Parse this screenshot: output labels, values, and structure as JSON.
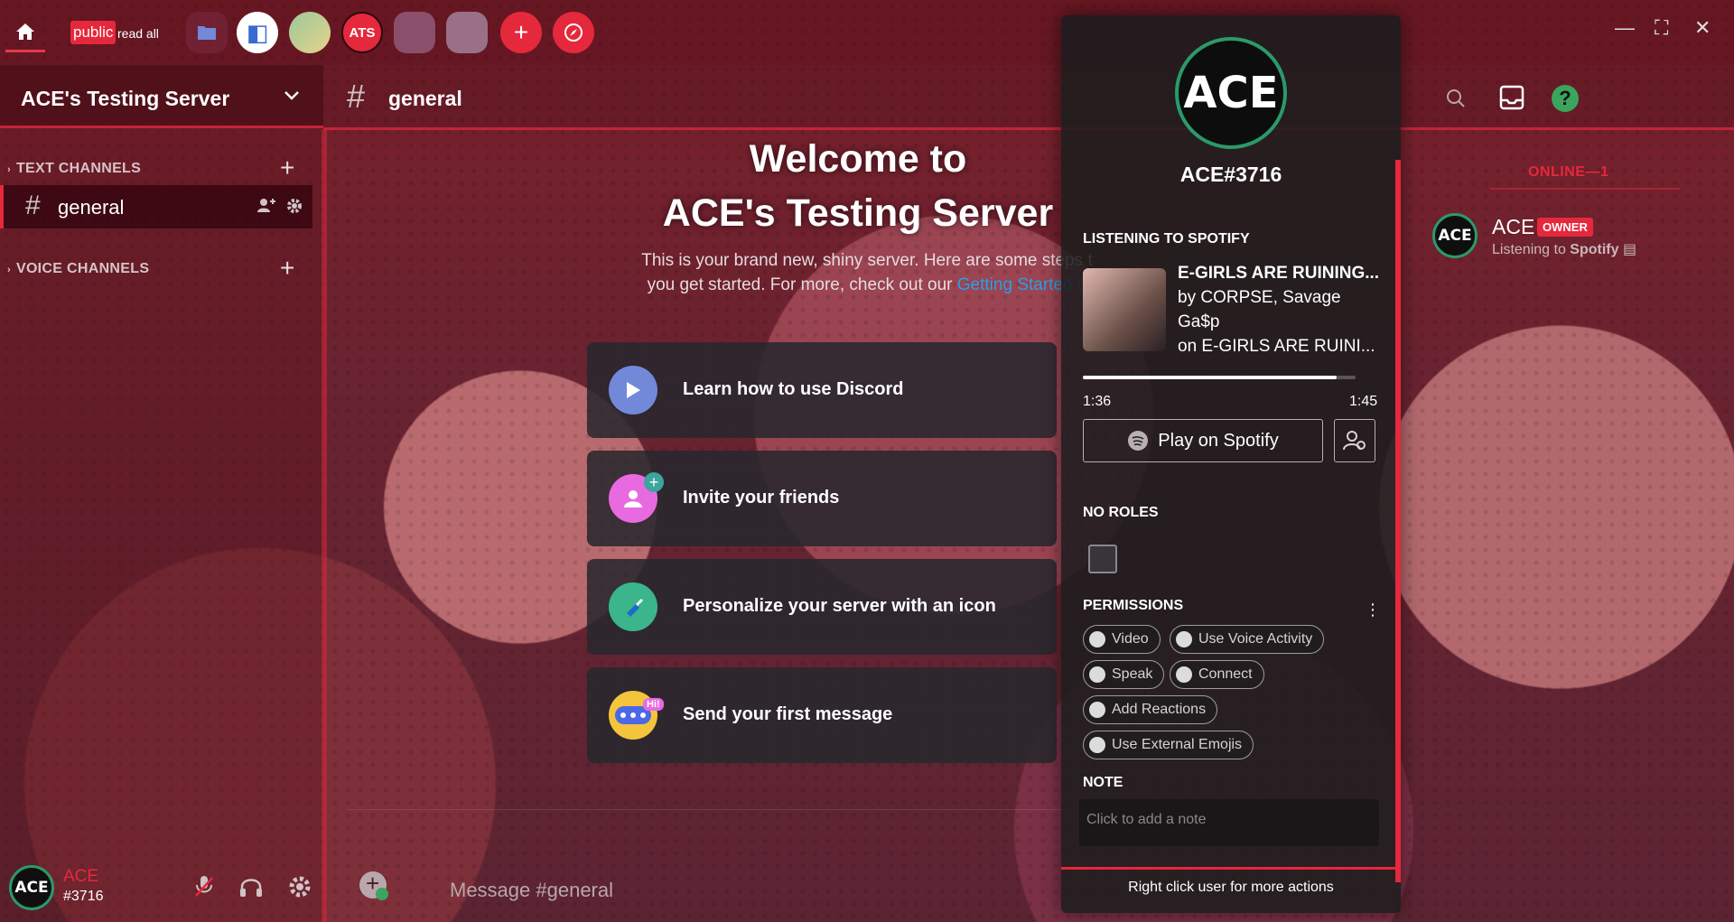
{
  "topbar": {
    "tag_public": "public",
    "tag_read_all": "read all",
    "server_ats": "ATS",
    "colors": {
      "accent": "#e6283c",
      "online": "#2a9a6a"
    }
  },
  "sidebar": {
    "server_name": "ACE's Testing Server",
    "text_category": "TEXT CHANNELS",
    "voice_category": "VOICE CHANNELS",
    "channel": "general"
  },
  "userbar": {
    "name": "ACE",
    "discriminator": "#3716",
    "avatar_text": "ACE"
  },
  "channel_header": {
    "title": "general"
  },
  "welcome": {
    "title_line1": "Welcome to",
    "title_line2": "ACE's Testing Server",
    "sub_line1": "This is your brand new, shiny server. Here are some steps t",
    "sub_line2_prefix": "you get started. For more, check out our",
    "sub_link": "Getting Started g",
    "cards": [
      {
        "label": "Learn how to use Discord",
        "icon": "play-icon"
      },
      {
        "label": "Invite your friends",
        "icon": "invite-friends-icon"
      },
      {
        "label": "Personalize your server with an icon",
        "icon": "brush-icon"
      },
      {
        "label": "Send your first message",
        "icon": "chat-bubble-icon"
      }
    ],
    "card_badge": "Hi!"
  },
  "message": {
    "placeholder": "Message #general"
  },
  "members": {
    "online_label": "ONLINE—1",
    "member_name": "ACE",
    "owner_badge": "OWNER",
    "status_prefix": "Listening to",
    "status_app": "Spotify",
    "avatar_text": "ACE"
  },
  "popout": {
    "avatar_text": "ACE",
    "username": "ACE#3716",
    "listening_label": "LISTENING TO SPOTIFY",
    "song_title": "E-GIRLS ARE RUINING...",
    "song_by_line1": "by CORPSE, Savage",
    "song_by_line2": "Ga$p",
    "song_on": "on E-GIRLS ARE RUINI...",
    "time_current": "1:36",
    "time_total": "1:45",
    "progress_fraction": 0.93,
    "play_button": "Play on Spotify",
    "roles_label": "NO ROLES",
    "permissions_label": "PERMISSIONS",
    "permissions": [
      "Video",
      "Use Voice Activity",
      "Speak",
      "Connect",
      "Add Reactions",
      "Use External Emojis"
    ],
    "note_label": "NOTE",
    "note_placeholder": "Click to add a note",
    "footer": "Right click user for more actions"
  }
}
